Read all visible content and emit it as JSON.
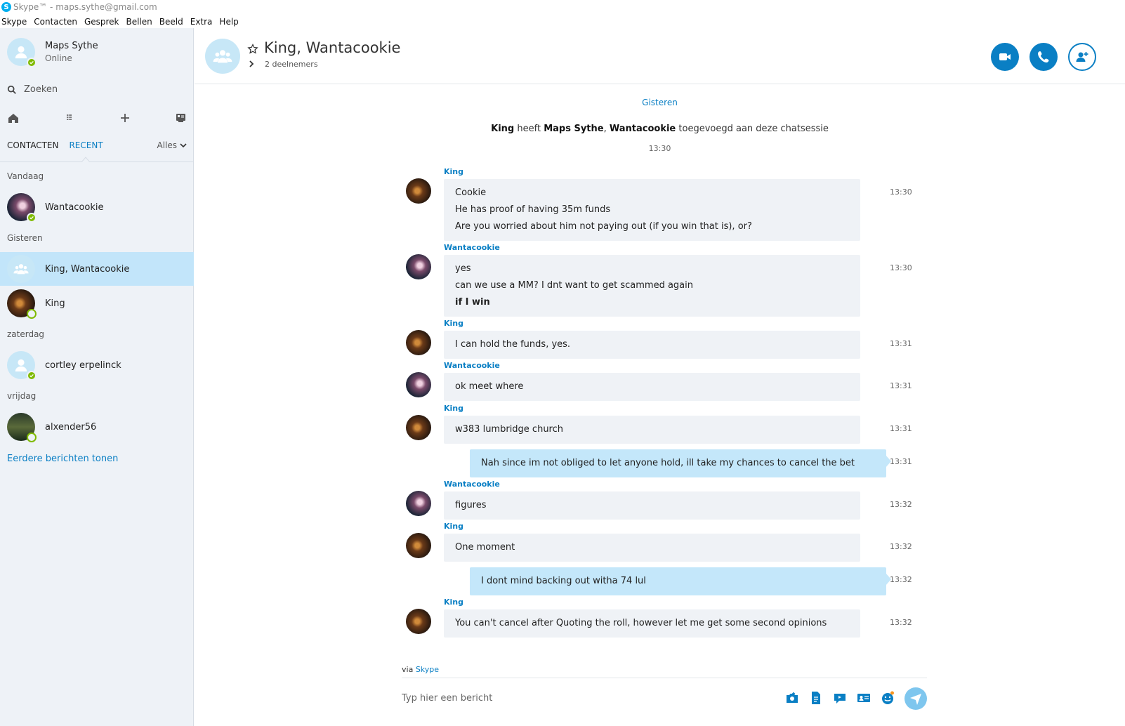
{
  "window": {
    "title": "Skype™ - maps.sythe@gmail.com"
  },
  "menu": [
    "Skype",
    "Contacten",
    "Gesprek",
    "Bellen",
    "Beeld",
    "Extra",
    "Help"
  ],
  "profile": {
    "name": "Maps Sythe",
    "status": "Online"
  },
  "search": {
    "placeholder": "Zoeken"
  },
  "tabs": {
    "contacts": "CONTACTEN",
    "recent": "RECENT",
    "filter": "Alles"
  },
  "groups": {
    "today": "Vandaag",
    "yesterday": "Gisteren",
    "saturday": "zaterdag",
    "friday": "vrijdag"
  },
  "contacts": [
    {
      "name": "Wantacookie"
    },
    {
      "name": "King, Wantacookie"
    },
    {
      "name": "King"
    },
    {
      "name": "cortley erpelinck"
    },
    {
      "name": "alxender56"
    }
  ],
  "more_link": "Eerdere berichten tonen",
  "header": {
    "title": "King, Wantacookie",
    "participants": "2 deelnemers"
  },
  "conversation": {
    "date": "Gisteren",
    "system": {
      "actor": "King",
      "verb": "heeft",
      "added1": "Maps Sythe",
      "sep": ",",
      "added2": "Wantacookie",
      "rest": "toegevoegd aan deze chatsessie",
      "time": "13:30"
    },
    "messages": [
      {
        "sender": "King",
        "lines": [
          "Cookie",
          "He has proof of having 35m funds",
          "Are you worried about him not paying out (if you win that is), or?"
        ],
        "time": "13:30"
      },
      {
        "sender": "Wantacookie",
        "lines": [
          "yes",
          "can we use a MM? I dnt want to get scammed again",
          "if I win"
        ],
        "time": "13:30"
      },
      {
        "sender": "King",
        "lines": [
          "I can hold the funds, yes."
        ],
        "time": "13:31"
      },
      {
        "sender": "Wantacookie",
        "lines": [
          "ok meet where"
        ],
        "time": "13:31"
      },
      {
        "sender": "King",
        "lines": [
          "w383 lumbridge church"
        ],
        "time": "13:31"
      },
      {
        "sender": "",
        "lines": [
          "Nah since im not obliged to let anyone hold, ill take my chances to cancel the bet"
        ],
        "time": "13:31"
      },
      {
        "sender": "Wantacookie",
        "lines": [
          "figures"
        ],
        "time": "13:32"
      },
      {
        "sender": "King",
        "lines": [
          "One moment"
        ],
        "time": "13:32"
      },
      {
        "sender": "",
        "lines": [
          "I dont mind backing out witha 74 lul"
        ],
        "time": "13:32"
      },
      {
        "sender": "King",
        "lines": [
          "You can't cancel after Quoting the roll, however let me get some second opinions"
        ],
        "time": "13:32"
      }
    ]
  },
  "footer": {
    "via_prefix": "via",
    "via_link": "Skype",
    "compose_placeholder": "Typ hier een bericht"
  },
  "colors": {
    "accent": "#0a7fc4",
    "online": "#7fba00",
    "selected": "#c2e5fa",
    "outgoing": "#c4e7fa"
  }
}
